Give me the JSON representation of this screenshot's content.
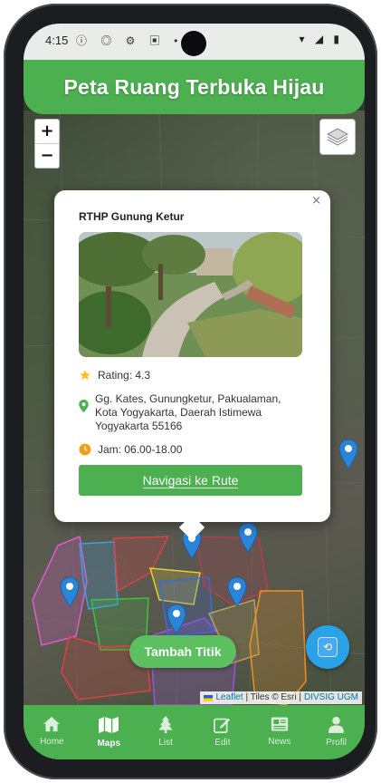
{
  "status_bar": {
    "time": "4:15",
    "left_icons": [
      "info-icon",
      "shield-icon",
      "bug-icon",
      "image-icon",
      "dot-icon"
    ],
    "right_icons": [
      "wifi-icon",
      "signal-icon",
      "battery-icon"
    ]
  },
  "app": {
    "title": "Peta Ruang Terbuka Hijau",
    "accent_color": "#4caf50"
  },
  "map_controls": {
    "zoom_in": "+",
    "zoom_out": "−"
  },
  "popup": {
    "close": "×",
    "title": "RTHP Gunung Ketur",
    "rating": "Rating: 4.3",
    "address": "Gg. Kates, Gunungketur, Pakualaman, Kota Yogyakarta, Daerah Istimewa Yogyakarta 55166",
    "hours": "Jam: 06.00-18.00",
    "nav_button": "Navigasi ke Rute"
  },
  "add_button": "Tambah Titik",
  "attribution": {
    "leaflet": "Leaflet",
    "tiles": "| Tiles © Esri |",
    "source": "DIVSIG UGM"
  },
  "bottom_nav": [
    {
      "label": "Home",
      "icon": "home-icon",
      "active": false
    },
    {
      "label": "Maps",
      "icon": "map-icon",
      "active": true
    },
    {
      "label": "List",
      "icon": "tree-icon",
      "active": false
    },
    {
      "label": "Edit",
      "icon": "edit-icon",
      "active": false
    },
    {
      "label": "News",
      "icon": "newspaper-icon",
      "active": false
    },
    {
      "label": "Profil",
      "icon": "user-icon",
      "active": false
    }
  ]
}
